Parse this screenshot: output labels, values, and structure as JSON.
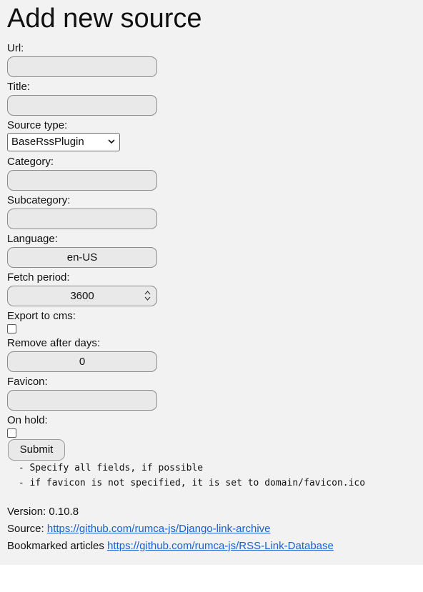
{
  "page": {
    "title": "Add new source"
  },
  "form": {
    "url": {
      "label": "Url:",
      "value": ""
    },
    "title": {
      "label": "Title:",
      "value": ""
    },
    "source_type": {
      "label": "Source type:",
      "selected": "BaseRssPlugin"
    },
    "category": {
      "label": "Category:",
      "value": ""
    },
    "subcategory": {
      "label": "Subcategory:",
      "value": ""
    },
    "language": {
      "label": "Language:",
      "value": "en-US"
    },
    "fetch_period": {
      "label": "Fetch period:",
      "value": "3600"
    },
    "export_to_cms": {
      "label": "Export to cms:",
      "checked": false
    },
    "remove_after_days": {
      "label": "Remove after days:",
      "value": "0"
    },
    "favicon": {
      "label": "Favicon:",
      "value": ""
    },
    "on_hold": {
      "label": "On hold:",
      "checked": false
    },
    "submit_label": "Submit"
  },
  "notes": [
    " - Specify all fields, if possible",
    " - if favicon is not specified, it is set to domain/favicon.ico"
  ],
  "footer": {
    "version": "Version: 0.10.8",
    "source_prefix": "Source: ",
    "source_link": "https://github.com/rumca-js/Django-link-archive",
    "bookmarked_prefix": "Bookmarked articles ",
    "bookmarked_link": "https://github.com/rumca-js/RSS-Link-Database"
  }
}
